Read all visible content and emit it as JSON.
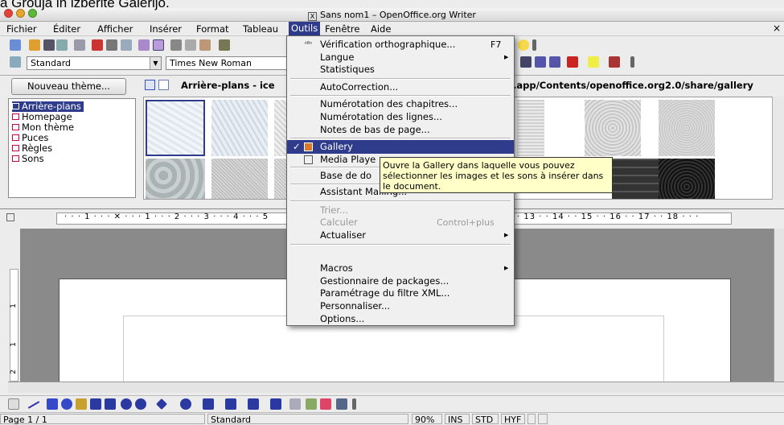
{
  "overlay_caption": "a Grouja in izberite Galerijo.",
  "window": {
    "title": "Sans nom1 – OpenOffice.org Writer"
  },
  "menubar": {
    "items": [
      "Fichier",
      "Éditer",
      "Afficher",
      "Insérer",
      "Format",
      "Tableau",
      "Outils",
      "Fenêtre",
      "Aide"
    ],
    "close": "×"
  },
  "toolbar": {
    "style_value": "Standard",
    "font_value": "Times New Roman"
  },
  "gallery": {
    "new_theme_button": "Nouveau thème...",
    "header": "Arrière-plans - ice",
    "path_fragment": ".app/Contents/openoffice.org2.0/share/gallery",
    "themes": [
      "Arrière-plans",
      "Homepage",
      "Mon thème",
      "Puces",
      "Règles",
      "Sons"
    ]
  },
  "ruler": {
    "labels_left": "· · · 1 · · · ✕ · · · 1 · · · 2 · · · 3 · · · 4 · · · 5",
    "labels_right": "· 13 · · 14 · · 15 · · 16 · · 17 · · 18 · · ·"
  },
  "vruler": {
    "labels": [
      "1",
      "1",
      "2"
    ]
  },
  "tools_menu": {
    "items": [
      {
        "label": "Vérification orthographique...",
        "shortcut": "F7"
      },
      {
        "label": "Langue",
        "submenu": "▶"
      },
      {
        "label": "Statistiques"
      },
      {
        "label": "AutoCorrection..."
      },
      {
        "label": "Numérotation des chapitres..."
      },
      {
        "label": "Numérotation des lignes..."
      },
      {
        "label": "Notes de bas de page..."
      },
      {
        "label": "Gallery",
        "checked": "✓"
      },
      {
        "label": "Media Playe"
      },
      {
        "label": "Base de do"
      },
      {
        "label": "Assistant Mailing..."
      },
      {
        "label": "Trier..."
      },
      {
        "label": "Calculer",
        "shortcut": "Control+plus"
      },
      {
        "label": "Actualiser",
        "submenu": "▶"
      },
      {
        "label": "Macros",
        "submenu": "▶"
      },
      {
        "label": "Gestionnaire de packages..."
      },
      {
        "label": "Paramétrage du filtre XML..."
      },
      {
        "label": "Personnaliser..."
      },
      {
        "label": "Options..."
      }
    ]
  },
  "tooltip": {
    "text": "Ouvre la Gallery dans laquelle vous pouvez sélectionner les images et les sons à insérer dans le document."
  },
  "statusbar": {
    "page": "Page 1 / 1",
    "style": "Standard",
    "zoom": "90%",
    "ins": "INS",
    "std": "STD",
    "hyp": "HYF"
  },
  "colors": {
    "highlight": "#2f3c8c",
    "tooltip_bg": "#ffffc8"
  }
}
